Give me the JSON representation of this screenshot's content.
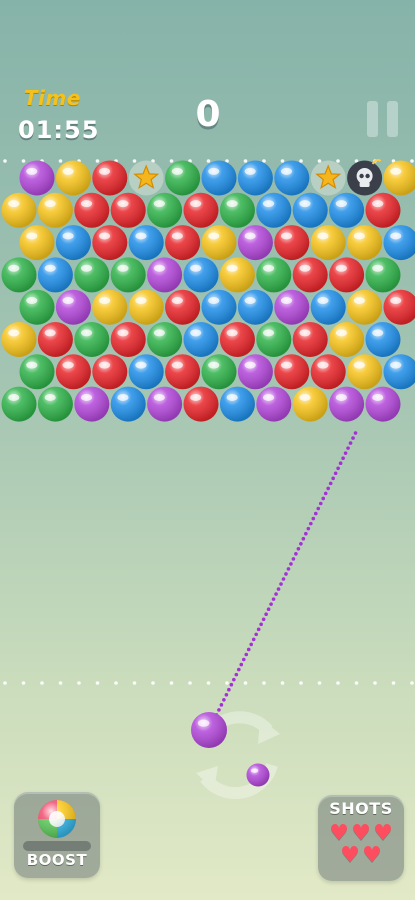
{
  "hud": {
    "time_label": "Time",
    "time_value": "01:55",
    "score": "0"
  },
  "board": {
    "rows": [
      [
        "purple",
        "yellow",
        "red",
        "star",
        "green",
        "blue",
        "blue",
        "blue",
        "star",
        "bomb",
        "yellow"
      ],
      [
        "yellow",
        "yellow",
        "red",
        "red",
        "green",
        "red",
        "green",
        "blue",
        "blue",
        "blue",
        "red"
      ],
      [
        "yellow",
        "blue",
        "red",
        "blue",
        "red",
        "yellow",
        "purple",
        "red",
        "yellow",
        "yellow",
        "blue"
      ],
      [
        "green",
        "blue",
        "green",
        "green",
        "purple",
        "blue",
        "yellow",
        "green",
        "red",
        "red",
        "green"
      ],
      [
        "green",
        "purple",
        "yellow",
        "yellow",
        "red",
        "blue",
        "blue",
        "purple",
        "blue",
        "yellow",
        "red"
      ],
      [
        "yellow",
        "red",
        "green",
        "red",
        "green",
        "blue",
        "red",
        "green",
        "red",
        "yellow",
        "blue"
      ],
      [
        "green",
        "red",
        "red",
        "blue",
        "red",
        "green",
        "purple",
        "red",
        "red",
        "yellow",
        "blue"
      ],
      [
        "green",
        "green",
        "purple",
        "blue",
        "purple",
        "red",
        "blue",
        "purple",
        "yellow",
        "purple",
        "purple"
      ]
    ],
    "colors": {
      "red": "#e8262b",
      "yellow": "#f6c31b",
      "green": "#2fb24a",
      "blue": "#1f8ee8",
      "purple": "#b247d9"
    }
  },
  "shooter": {
    "current_ball": "purple",
    "next_ball": "purple"
  },
  "boost": {
    "label": "BOOST"
  },
  "shots": {
    "label": "SHOTS",
    "hearts_remaining": 5
  }
}
